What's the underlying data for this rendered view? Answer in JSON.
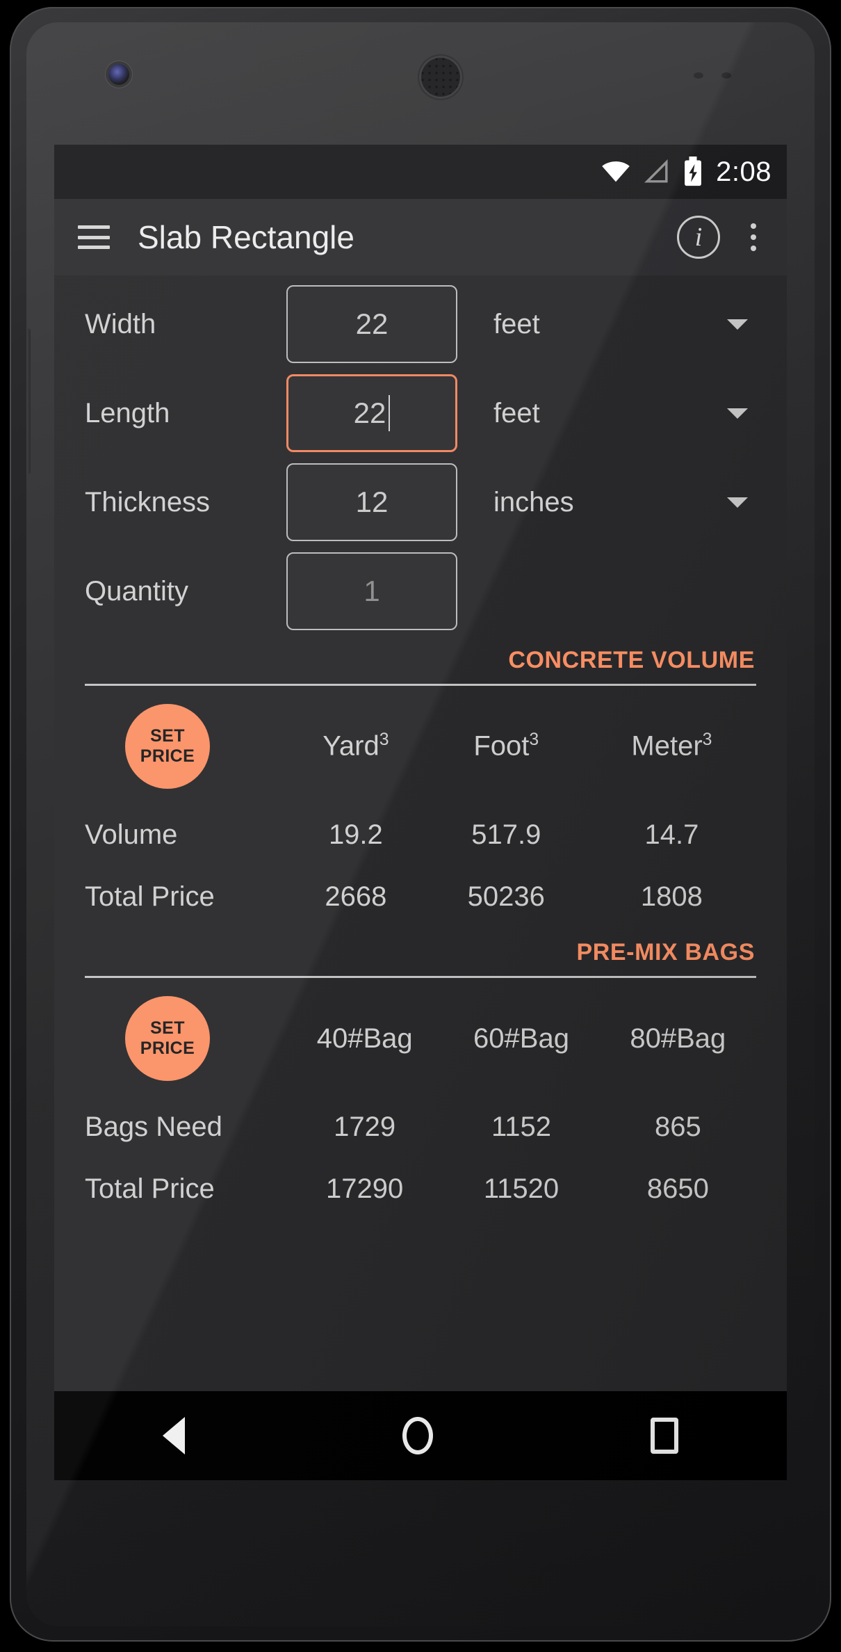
{
  "status_bar": {
    "time": "2:08",
    "icons": [
      "wifi-icon",
      "cell-signal-icon",
      "battery-charging-icon"
    ]
  },
  "app_bar": {
    "menu_icon": "hamburger-menu-icon",
    "title": "Slab Rectangle",
    "info_icon": "info-icon",
    "info_glyph": "i",
    "overflow_icon": "overflow-menu-icon"
  },
  "inputs": [
    {
      "label": "Width",
      "value": "22",
      "unit": "feet",
      "focused": false,
      "placeholder": false,
      "has_unit": true
    },
    {
      "label": "Length",
      "value": "22",
      "unit": "feet",
      "focused": true,
      "placeholder": false,
      "has_unit": true
    },
    {
      "label": "Thickness",
      "value": "12",
      "unit": "inches",
      "focused": false,
      "placeholder": false,
      "has_unit": true
    },
    {
      "label": "Quantity",
      "value": "1",
      "unit": "",
      "focused": false,
      "placeholder": true,
      "has_unit": false
    }
  ],
  "volume_section": {
    "title": "CONCRETE VOLUME",
    "set_price_label_line1": "SET",
    "set_price_label_line2": "PRICE",
    "columns": [
      "Yard³",
      "Foot³",
      "Meter³"
    ],
    "column_bases": [
      "Yard",
      "Foot",
      "Meter"
    ],
    "column_exponent": "3",
    "rows": [
      {
        "label": "Volume",
        "values": [
          "19.2",
          "517.9",
          "14.7"
        ]
      },
      {
        "label": "Total Price",
        "values": [
          "2668",
          "50236",
          "1808"
        ]
      }
    ]
  },
  "bags_section": {
    "title": "PRE-MIX BAGS",
    "set_price_label_line1": "SET",
    "set_price_label_line2": "PRICE",
    "columns": [
      "40#Bag",
      "60#Bag",
      "80#Bag"
    ],
    "rows": [
      {
        "label": "Bags Need",
        "values": [
          "1729",
          "1152",
          "865"
        ]
      },
      {
        "label": "Total Price",
        "values": [
          "17290",
          "11520",
          "8650"
        ]
      }
    ]
  },
  "nav_bar": {
    "back": "back-nav-icon",
    "home": "home-nav-icon",
    "recents": "recents-nav-icon"
  },
  "colors": {
    "accent": "#fb8f63",
    "screen_bg": "#272729",
    "app_bar_bg": "#2d2d30",
    "status_bar_bg": "#1b1b1d",
    "text": "#cfcfcf"
  }
}
